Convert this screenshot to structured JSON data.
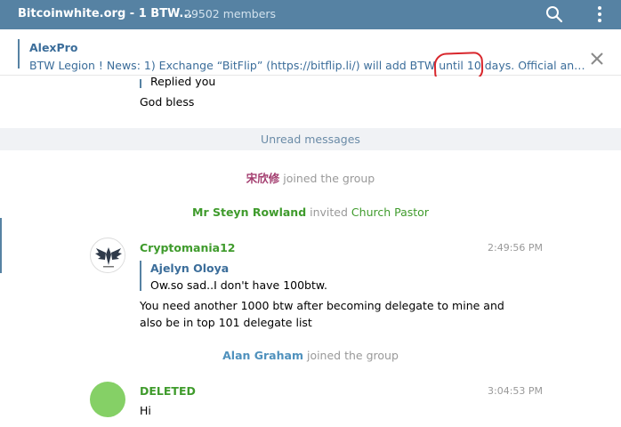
{
  "header": {
    "title": "Bitcoinwhite.org - 1 BTW...",
    "members": "29502 members",
    "icons": [
      "search-icon",
      "more-vertical-icon"
    ],
    "color": "#5682a3"
  },
  "pinned": {
    "author": "AlexPro",
    "text": "BTW Legion ! News: 1) Exchange “BitFlip” (https://bitflip.li/) will add BTW until 10 days. Official announce ...",
    "close_icon": "close-icon"
  },
  "feed": {
    "prev_reply_snippet": "Replied you",
    "prev_message": "God bless",
    "unread_label": "Unread messages",
    "service_1": {
      "name": "宋欣修",
      "text": "joined the group",
      "name_color": "#a33d6f"
    },
    "service_2": {
      "actor": "Mr Steyn Rowland",
      "verb": "invited",
      "target": "Church Pastor",
      "color": "#3f9b2c"
    },
    "message_1": {
      "author": "Cryptomania12",
      "time": "2:49:56 PM",
      "quote_author": "Ajelyn Oloya",
      "quote_text": "Ow.so sad..I don't have 100btw.",
      "line1": "You need another 1000 btw after becoming delegate to mine and",
      "line2": "also be in top 101 delegate list",
      "author_color": "#3f9b2c"
    },
    "service_3": {
      "name": "Alan Graham",
      "text": "joined the group",
      "name_color": "#4f91bd"
    },
    "message_2": {
      "author": "DELETED",
      "time": "3:04:53 PM",
      "text": "Hi",
      "author_color": "#3f9b2c",
      "avatar_color": "#85d066"
    }
  }
}
